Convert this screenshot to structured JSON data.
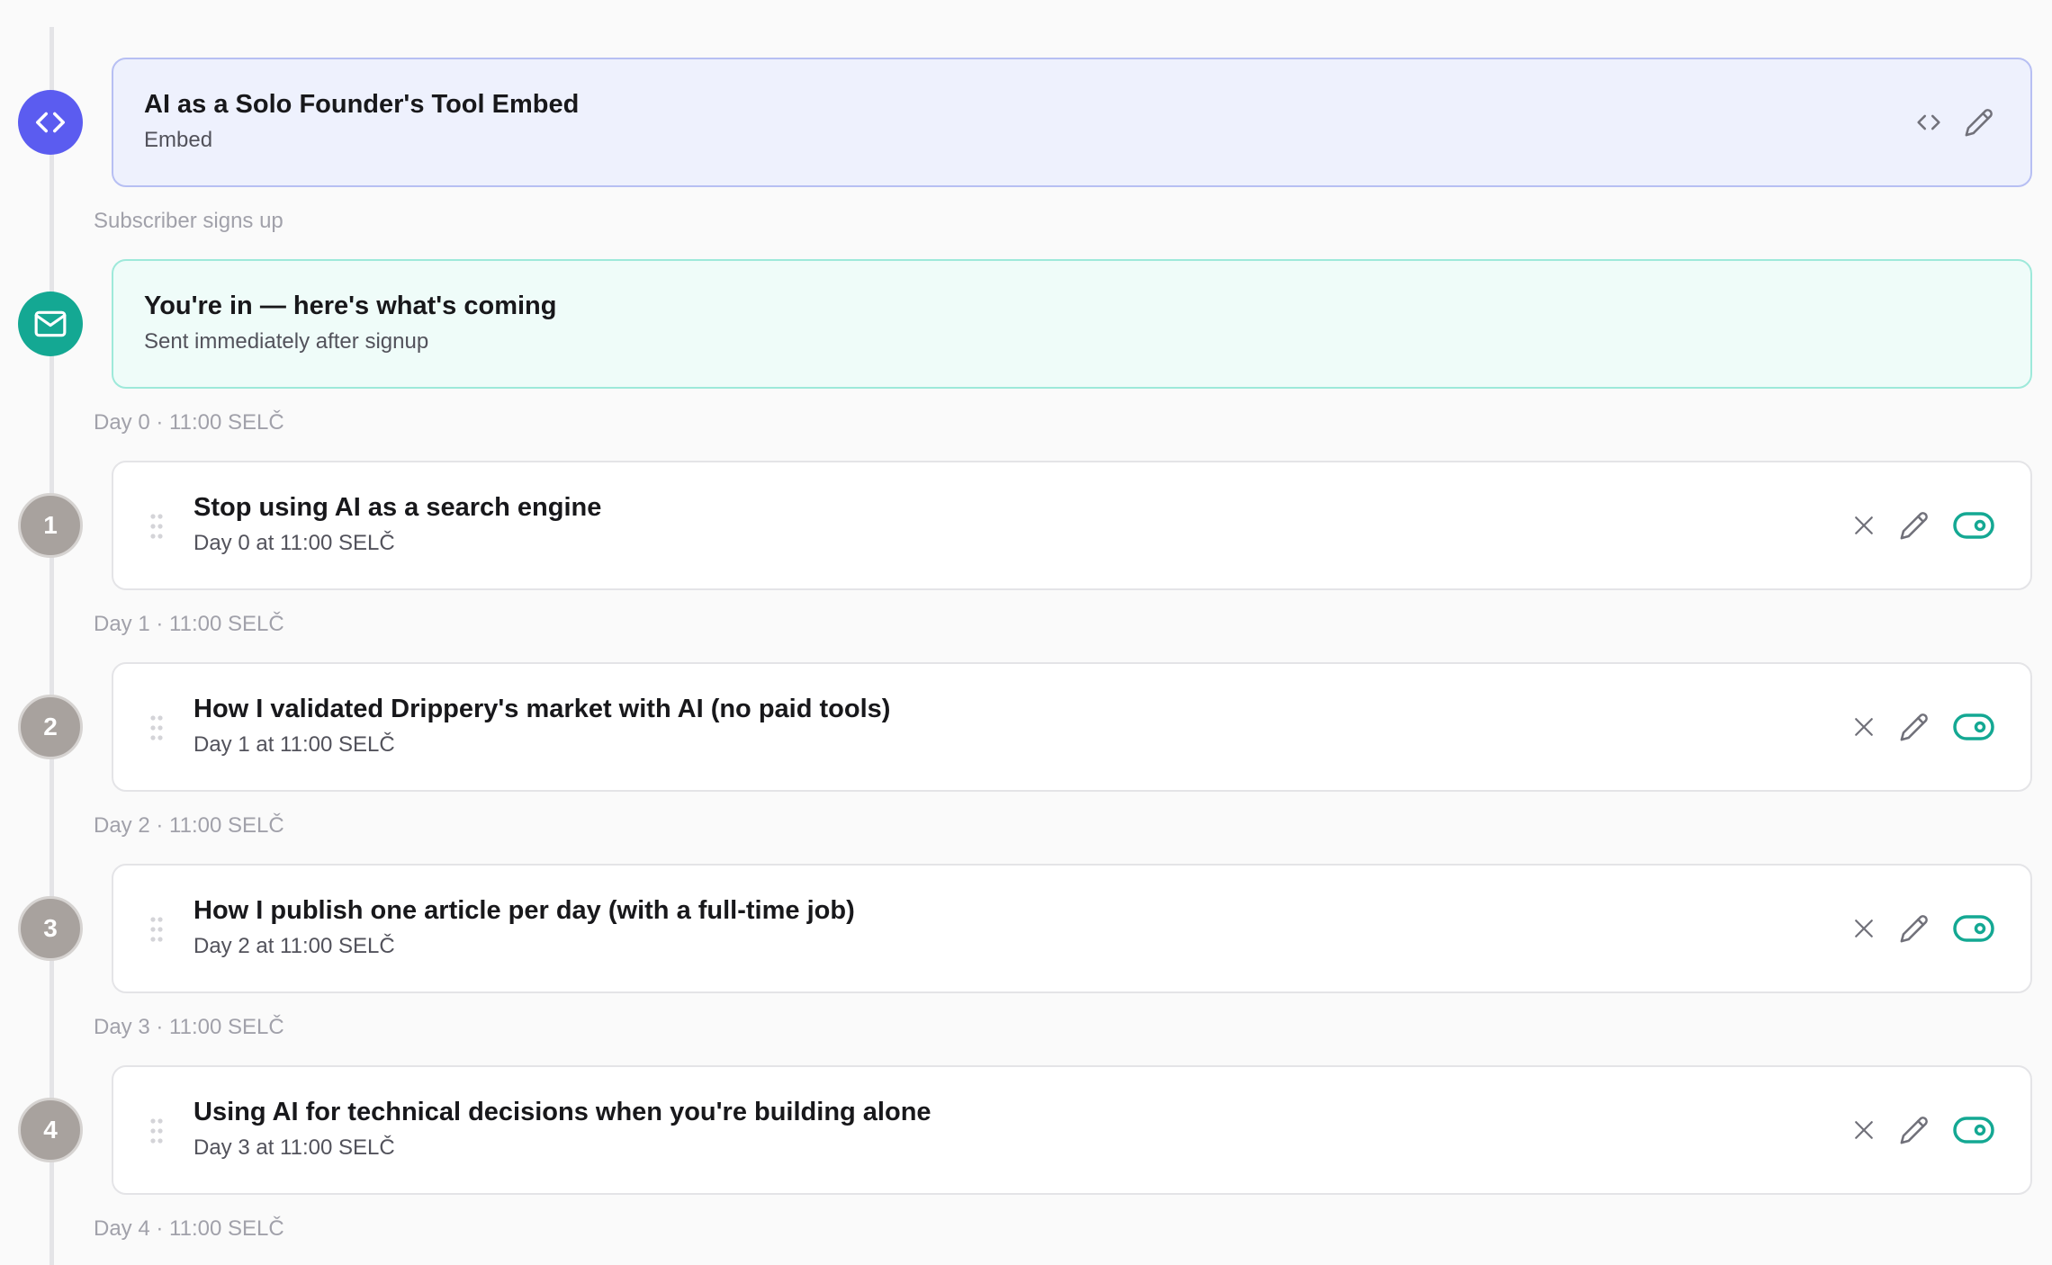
{
  "embed": {
    "title": "AI as a Solo Founder's Tool Embed",
    "subtitle": "Embed",
    "node_icon": "code-icon",
    "color": "#5b5cf0"
  },
  "trigger_label": "Subscriber signs up",
  "welcome": {
    "title": "You're in — here's what's coming",
    "subtitle": "Sent immediately after signup",
    "node_icon": "mail-icon",
    "color": "#14a893"
  },
  "steps": [
    {
      "number": "1",
      "title": "Stop using AI as a search engine",
      "schedule": "Day 0 at 11:00 SELČ",
      "label_before": "Day 0 · 11:00 SELČ",
      "enabled": true
    },
    {
      "number": "2",
      "title": "How I validated Drippery's market with AI (no paid tools)",
      "schedule": "Day 1 at 11:00 SELČ",
      "label_before": "Day 1 · 11:00 SELČ",
      "enabled": true
    },
    {
      "number": "3",
      "title": "How I publish one article per day (with a full-time job)",
      "schedule": "Day 2 at 11:00 SELČ",
      "label_before": "Day 2 · 11:00 SELČ",
      "enabled": true
    },
    {
      "number": "4",
      "title": "Using AI for technical decisions when you're building alone",
      "schedule": "Day 3 at 11:00 SELČ",
      "label_before": "Day 3 · 11:00 SELČ",
      "enabled": true
    }
  ],
  "trailing_label": "Day 4 · 11:00 SELČ",
  "colors": {
    "toggle_on": "#14a893",
    "step_node": "#a8a29e"
  }
}
